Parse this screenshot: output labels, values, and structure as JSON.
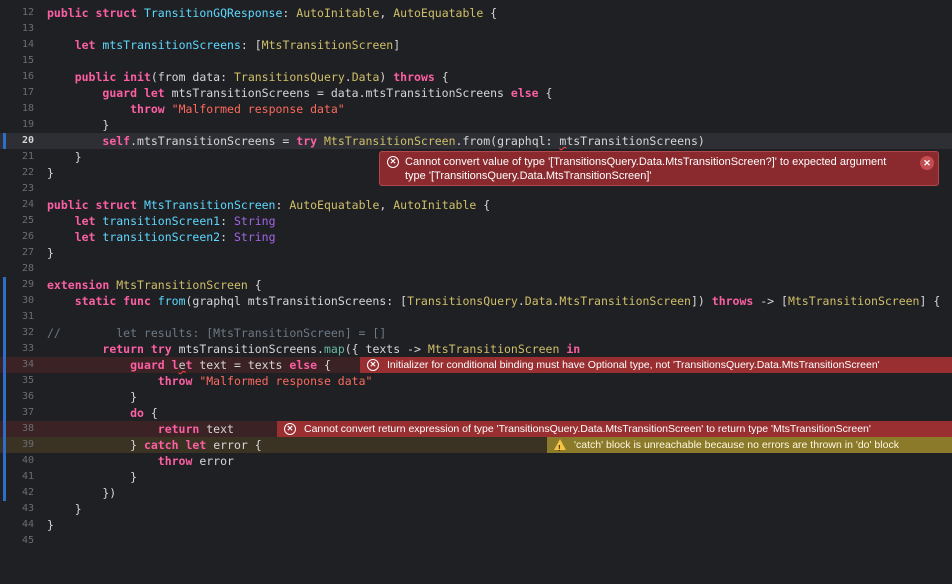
{
  "editor": {
    "lines": [
      {
        "n": "12",
        "tokens": [
          [
            "kw",
            "public "
          ],
          [
            "kw",
            "struct "
          ],
          [
            "ty",
            "TransitionGQResponse"
          ],
          [
            "plain",
            ": "
          ],
          [
            "ty2",
            "AutoInitable"
          ],
          [
            "plain",
            ", "
          ],
          [
            "ty2",
            "AutoEquatable"
          ],
          [
            "plain",
            " {"
          ]
        ]
      },
      {
        "n": "13",
        "tokens": []
      },
      {
        "n": "14",
        "tokens": [
          [
            "plain",
            "    "
          ],
          [
            "kw",
            "let "
          ],
          [
            "ty",
            "mtsTransitionScreens"
          ],
          [
            "plain",
            ": ["
          ],
          [
            "ty2",
            "MtsTransitionScreen"
          ],
          [
            "plain",
            "]"
          ]
        ]
      },
      {
        "n": "15",
        "tokens": []
      },
      {
        "n": "16",
        "tokens": [
          [
            "plain",
            "    "
          ],
          [
            "kw",
            "public "
          ],
          [
            "kw",
            "init"
          ],
          [
            "plain",
            "(from data: "
          ],
          [
            "ty2",
            "TransitionsQuery"
          ],
          [
            "plain",
            "."
          ],
          [
            "ty2",
            "Data"
          ],
          [
            "plain",
            ") "
          ],
          [
            "kw",
            "throws"
          ],
          [
            "plain",
            " {"
          ]
        ]
      },
      {
        "n": "17",
        "tokens": [
          [
            "plain",
            "        "
          ],
          [
            "kw",
            "guard "
          ],
          [
            "kw",
            "let "
          ],
          [
            "plain",
            "mtsTransitionScreens = data.mtsTransitionScreens "
          ],
          [
            "kw",
            "else"
          ],
          [
            "plain",
            " {"
          ]
        ]
      },
      {
        "n": "18",
        "tokens": [
          [
            "plain",
            "            "
          ],
          [
            "kw",
            "throw "
          ],
          [
            "str",
            "\"Malformed response data\""
          ]
        ]
      },
      {
        "n": "19",
        "tokens": [
          [
            "plain",
            "        }"
          ]
        ]
      },
      {
        "n": "20",
        "tokens": [
          [
            "plain",
            "        "
          ],
          [
            "kw",
            "self"
          ],
          [
            "plain",
            ".mtsTransitionScreens = "
          ],
          [
            "kw",
            "try "
          ],
          [
            "ty2",
            "MtsTransitionScreen"
          ],
          [
            "plain",
            ".from(graphql: "
          ],
          [
            "squig",
            "m"
          ],
          [
            "plain",
            "tsTransitionScreens)"
          ]
        ]
      },
      {
        "n": "21",
        "tokens": [
          [
            "plain",
            "    }"
          ]
        ]
      },
      {
        "n": "22",
        "tokens": [
          [
            "plain",
            "}"
          ]
        ]
      },
      {
        "n": "23",
        "tokens": []
      },
      {
        "n": "24",
        "tokens": [
          [
            "kw",
            "public "
          ],
          [
            "kw",
            "struct "
          ],
          [
            "ty",
            "MtsTransitionScreen"
          ],
          [
            "plain",
            ": "
          ],
          [
            "ty2",
            "AutoEquatable"
          ],
          [
            "plain",
            ", "
          ],
          [
            "ty2",
            "AutoInitable"
          ],
          [
            "plain",
            " {"
          ]
        ]
      },
      {
        "n": "25",
        "tokens": [
          [
            "plain",
            "    "
          ],
          [
            "kw",
            "let "
          ],
          [
            "ty",
            "transitionScreen1"
          ],
          [
            "plain",
            ": "
          ],
          [
            "ty3",
            "String"
          ]
        ]
      },
      {
        "n": "26",
        "tokens": [
          [
            "plain",
            "    "
          ],
          [
            "kw",
            "let "
          ],
          [
            "ty",
            "transitionScreen2"
          ],
          [
            "plain",
            ": "
          ],
          [
            "ty3",
            "String"
          ]
        ]
      },
      {
        "n": "27",
        "tokens": [
          [
            "plain",
            "}"
          ]
        ]
      },
      {
        "n": "28",
        "tokens": []
      },
      {
        "n": "29",
        "tokens": [
          [
            "kw",
            "extension "
          ],
          [
            "ty2",
            "MtsTransitionScreen"
          ],
          [
            "plain",
            " {"
          ]
        ]
      },
      {
        "n": "30",
        "tokens": [
          [
            "plain",
            "    "
          ],
          [
            "kw",
            "static "
          ],
          [
            "kw",
            "func "
          ],
          [
            "ty",
            "from"
          ],
          [
            "plain",
            "(graphql mtsTransitionScreens: ["
          ],
          [
            "ty2",
            "TransitionsQuery"
          ],
          [
            "plain",
            "."
          ],
          [
            "ty2",
            "Data"
          ],
          [
            "plain",
            "."
          ],
          [
            "ty2",
            "MtsTransitionScreen"
          ],
          [
            "plain",
            "]) "
          ],
          [
            "kw",
            "throws"
          ],
          [
            "plain",
            " -> ["
          ],
          [
            "ty2",
            "MtsTransitionScreen"
          ],
          [
            "plain",
            "] {"
          ]
        ]
      },
      {
        "n": "31",
        "tokens": []
      },
      {
        "n": "32",
        "tokens": [
          [
            "cm",
            "//        let results: [MtsTransitionScreen] = []"
          ]
        ]
      },
      {
        "n": "33",
        "tokens": [
          [
            "plain",
            "        "
          ],
          [
            "kw",
            "return "
          ],
          [
            "kw",
            "try "
          ],
          [
            "plain",
            "mtsTransitionScreens."
          ],
          [
            "fn",
            "map"
          ],
          [
            "plain",
            "({ texts -> "
          ],
          [
            "ty2",
            "MtsTransitionScreen"
          ],
          [
            "plain",
            " "
          ],
          [
            "kw",
            "in"
          ]
        ]
      },
      {
        "n": "34",
        "tokens": [
          [
            "plain",
            "            "
          ],
          [
            "kw",
            "guard "
          ],
          [
            "kw",
            "l"
          ],
          [
            "squig",
            "e"
          ],
          [
            "kw",
            "t "
          ],
          [
            "plain",
            "text = texts "
          ],
          [
            "kw",
            "else"
          ],
          [
            "plain",
            " {"
          ]
        ]
      },
      {
        "n": "35",
        "tokens": [
          [
            "plain",
            "                "
          ],
          [
            "kw",
            "throw "
          ],
          [
            "str",
            "\"Malformed response data\""
          ]
        ]
      },
      {
        "n": "36",
        "tokens": [
          [
            "plain",
            "            }"
          ]
        ]
      },
      {
        "n": "37",
        "tokens": [
          [
            "plain",
            "            "
          ],
          [
            "kw",
            "do"
          ],
          [
            "plain",
            " {"
          ]
        ]
      },
      {
        "n": "38",
        "tokens": [
          [
            "plain",
            "                "
          ],
          [
            "kw",
            "return "
          ],
          [
            "plain",
            "text"
          ]
        ]
      },
      {
        "n": "39",
        "tokens": [
          [
            "plain",
            "            } "
          ],
          [
            "kw",
            "catch "
          ],
          [
            "kw",
            "let "
          ],
          [
            "plain",
            "error {"
          ]
        ]
      },
      {
        "n": "40",
        "tokens": [
          [
            "plain",
            "                "
          ],
          [
            "kw",
            "throw "
          ],
          [
            "plain",
            "error"
          ]
        ]
      },
      {
        "n": "41",
        "tokens": [
          [
            "plain",
            "            }"
          ]
        ]
      },
      {
        "n": "42",
        "tokens": [
          [
            "plain",
            "        })"
          ]
        ]
      },
      {
        "n": "43",
        "tokens": [
          [
            "plain",
            "    }"
          ]
        ]
      },
      {
        "n": "44",
        "tokens": [
          [
            "plain",
            "}"
          ]
        ]
      },
      {
        "n": "45",
        "tokens": []
      }
    ]
  },
  "popup": {
    "icon": "error-circle-icon",
    "message": "Cannot convert value of type '[TransitionsQuery.Data.MtsTransitionScreen?]' to expected argument type '[TransitionsQuery.Data.MtsTransitionScreen]'",
    "close_icon": "close-icon"
  },
  "badges": {
    "line34": "Initializer for conditional binding must have Optional type, not 'TransitionsQuery.Data.MtsTransitionScreen'",
    "line38": "Cannot convert return expression of type 'TransitionsQuery.Data.MtsTransitionScreen' to return type 'MtsTransitionScreen'",
    "line39": "'catch' block is unreachable because no errors are thrown in 'do' block"
  },
  "colors": {
    "background": "#1f2024",
    "keyword": "#fc5fa3",
    "type": "#5dd8ff",
    "type_other": "#d0bf69",
    "string": "#fc6a5d",
    "comment": "#6c7986",
    "error": "#9a2f32",
    "warning": "#8c7a2b"
  }
}
